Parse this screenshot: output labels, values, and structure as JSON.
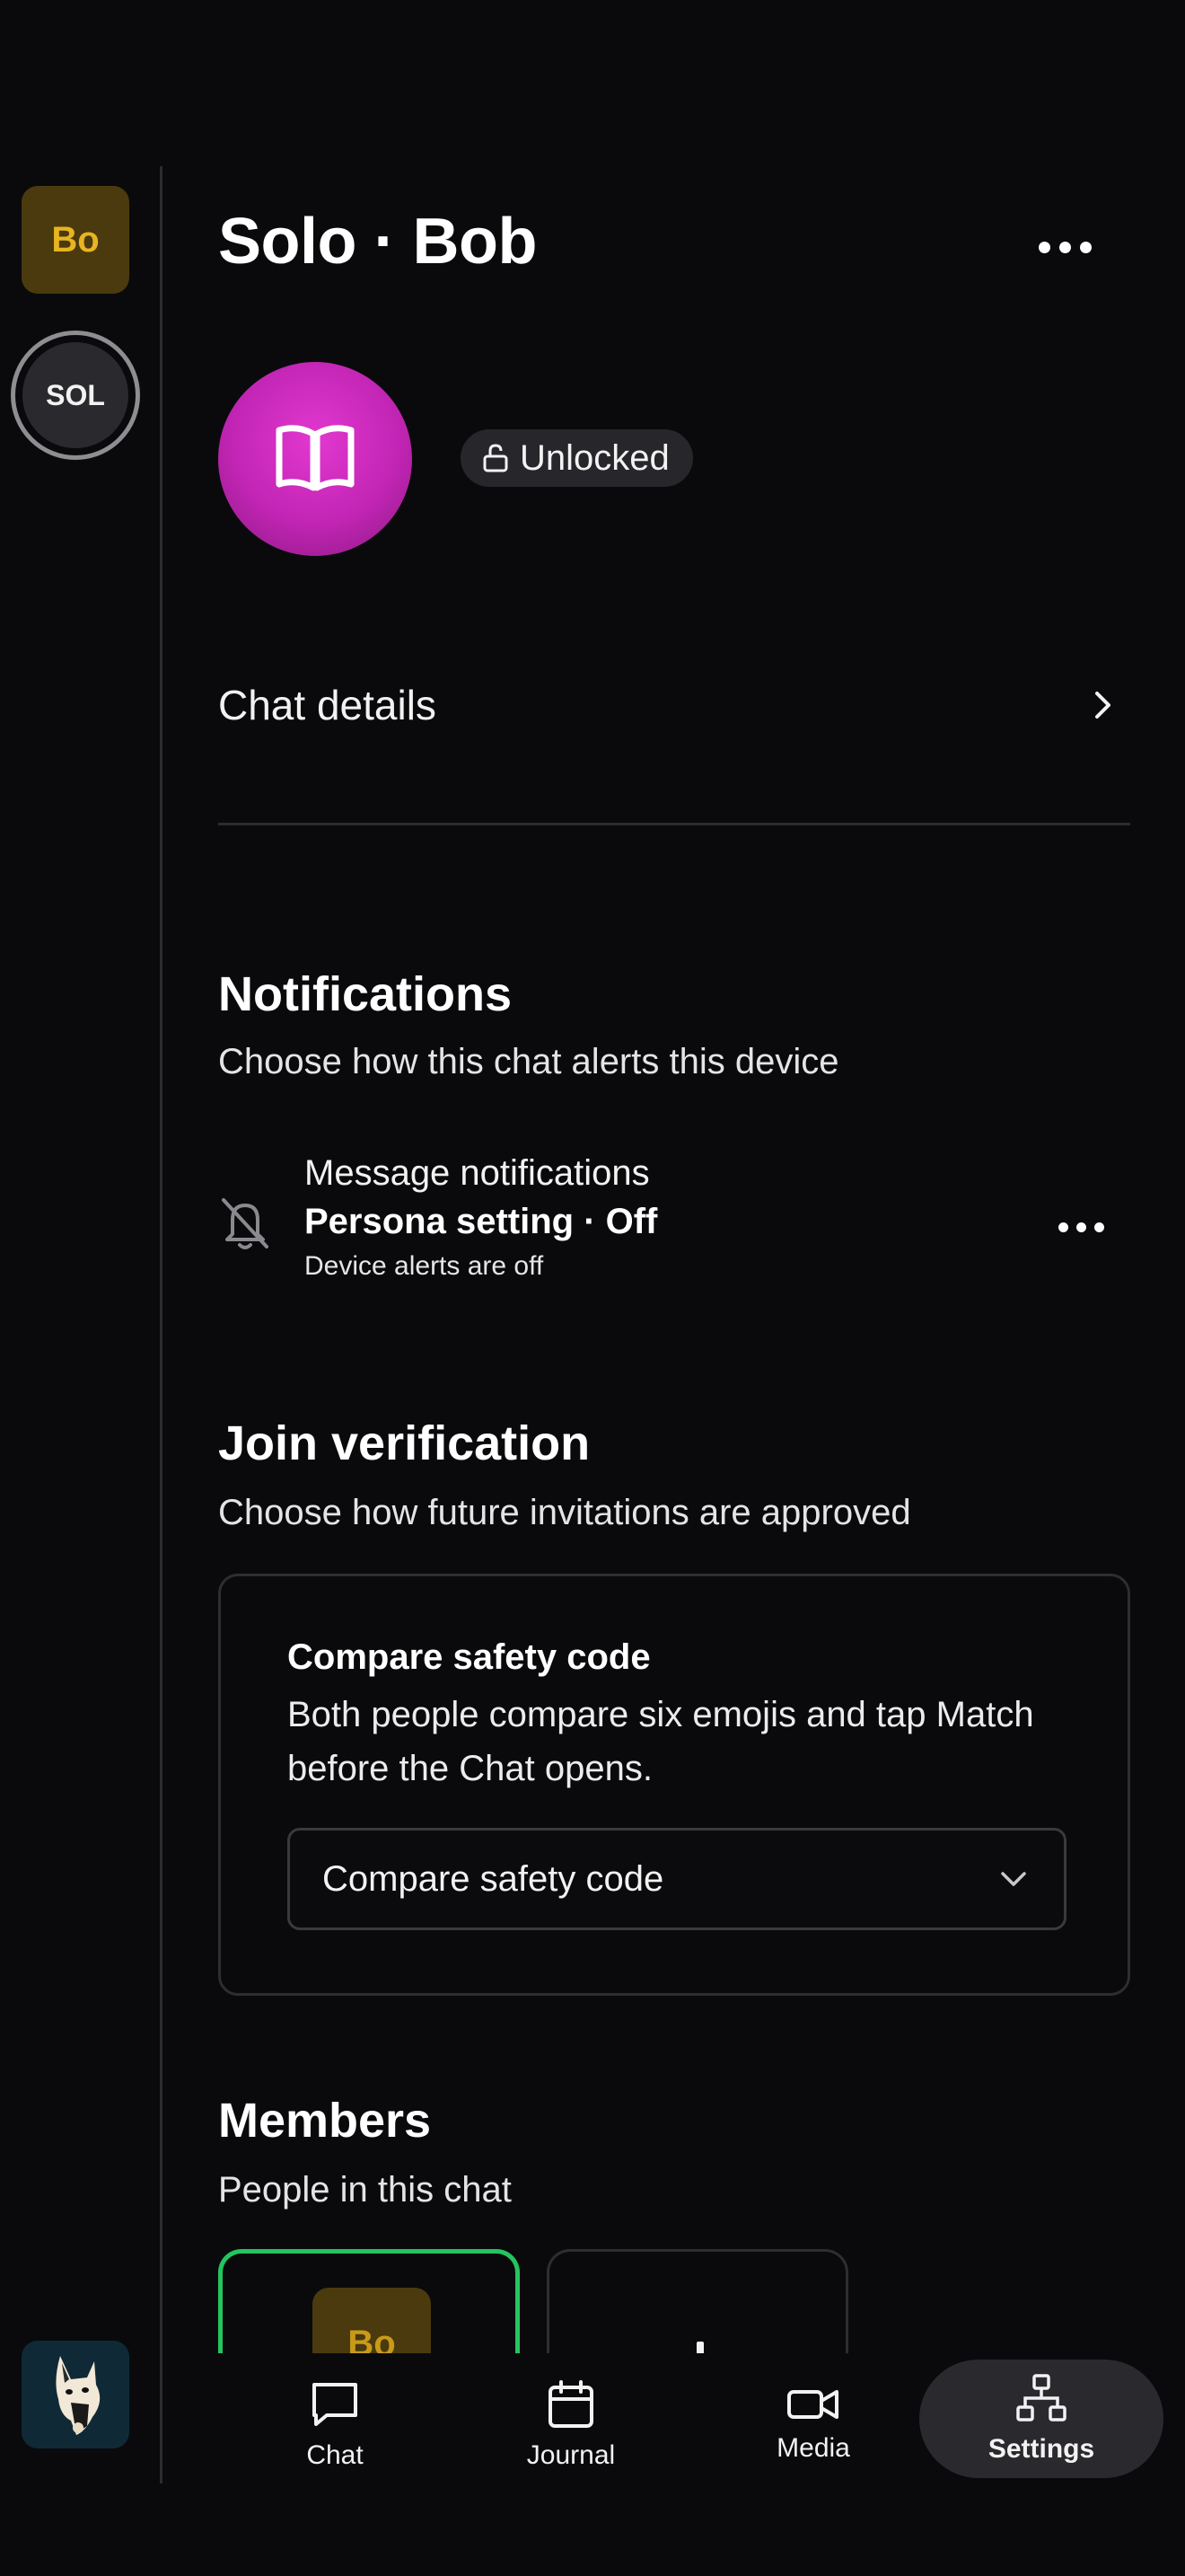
{
  "rail": {
    "avatars": [
      {
        "initials": "Bo"
      },
      {
        "initials": "SOL"
      }
    ],
    "app_icon": "cat-icon"
  },
  "header": {
    "title": "Solo · Bob",
    "more_icon": "more-horizontal-icon"
  },
  "profile": {
    "avatar_icon": "book-open-icon",
    "avatar_color": "#cc2abd",
    "lock_status": "Unlocked",
    "lock_icon": "unlock-icon"
  },
  "details": {
    "label": "Chat details",
    "icon": "chevron-right-icon"
  },
  "notifications": {
    "title": "Notifications",
    "subtitle": "Choose how this chat alerts this device",
    "row": {
      "icon": "bell-off-icon",
      "title": "Message notifications",
      "value": "Persona setting · Off",
      "hint": "Device alerts are off"
    }
  },
  "verification": {
    "title": "Join verification",
    "subtitle": "Choose how future invitations are approved",
    "card_title": "Compare safety code",
    "card_description": "Both people compare six emojis and tap Match before the Chat opens.",
    "select_value": "Compare safety code"
  },
  "members": {
    "title": "Members",
    "subtitle": "People in this chat",
    "items": [
      {
        "initials": "Bo",
        "selected": true,
        "accent": "#23c55e"
      }
    ]
  },
  "nav": {
    "items": [
      {
        "label": "Chat",
        "icon": "chat-icon"
      },
      {
        "label": "Journal",
        "icon": "calendar-icon"
      },
      {
        "label": "Media",
        "icon": "video-icon"
      },
      {
        "label": "Settings",
        "icon": "network-icon",
        "active": true
      }
    ]
  },
  "colors": {
    "background": "#0a0a0c",
    "surface": "#27272b",
    "bo_avatar_bg": "#4a3a0e",
    "bo_avatar_text": "#e8b420",
    "selected_border": "#23c55e"
  }
}
